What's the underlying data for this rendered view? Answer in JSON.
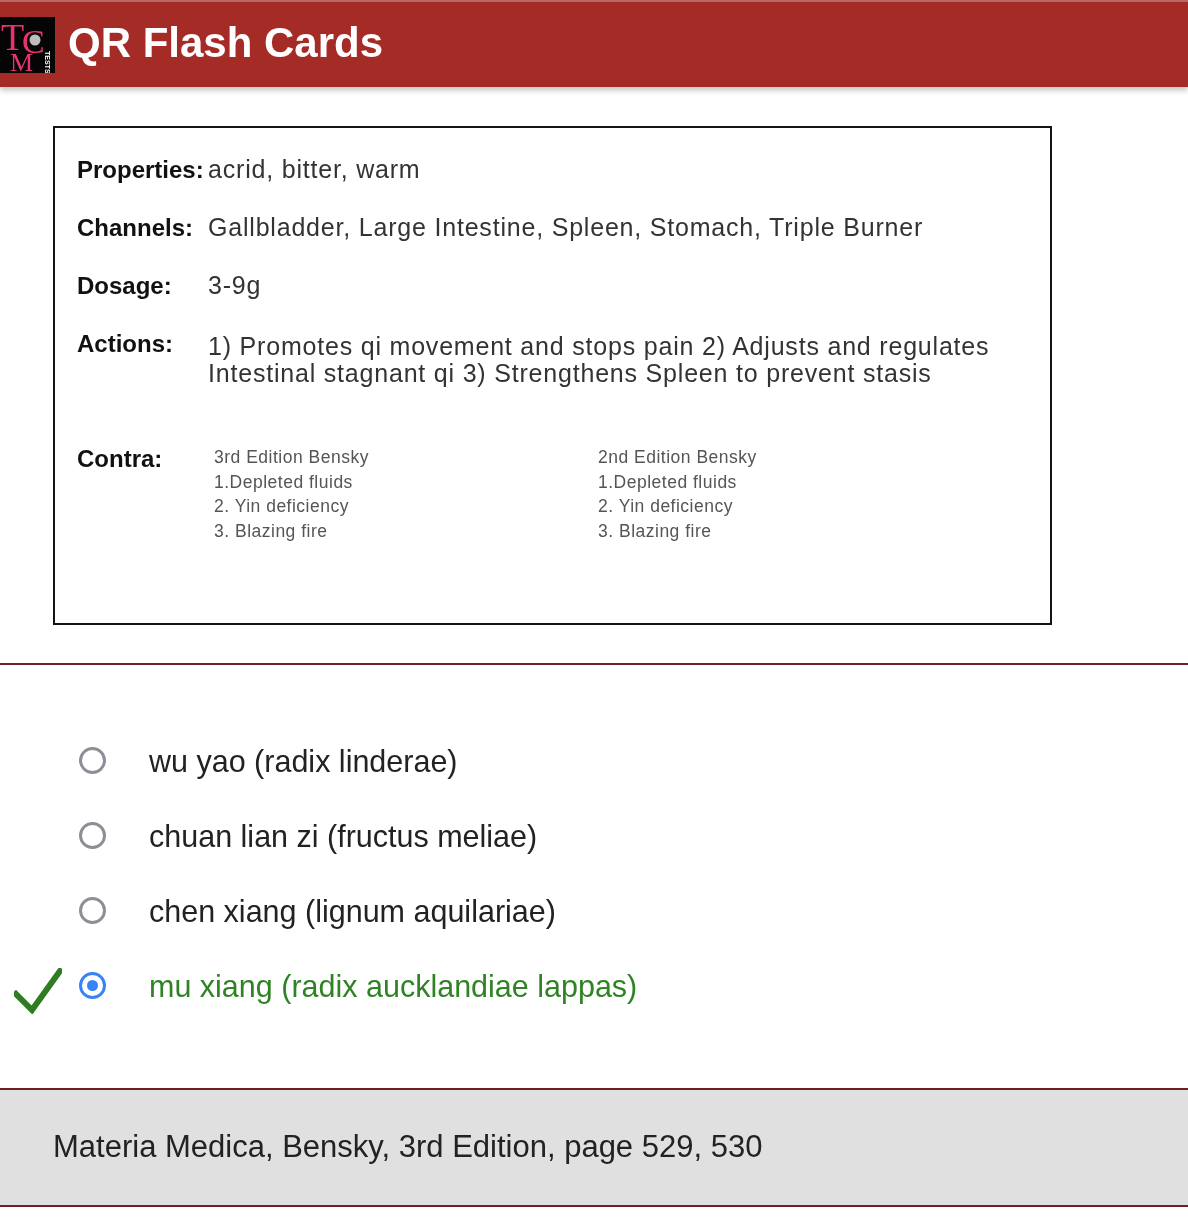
{
  "header": {
    "logo": {
      "letters": [
        "T",
        "C",
        "M"
      ],
      "tag": "TESTS"
    },
    "title": "QR Flash Cards"
  },
  "card": {
    "rows": [
      {
        "kind": "text",
        "label": "Properties:",
        "value": "acrid, bitter, warm"
      },
      {
        "kind": "text",
        "label": "Channels:",
        "value": "Gallbladder, Large Intestine, Spleen, Stomach, Triple Burner"
      },
      {
        "kind": "text",
        "label": "Dosage:",
        "value": "3-9g"
      },
      {
        "kind": "text",
        "label": "Actions:",
        "value": "1) Promotes qi movement and stops pain 2) Adjusts and regulates Intestinal stagnant qi 3) Strengthens Spleen to prevent stasis"
      },
      {
        "kind": "columns",
        "label": "Contra:",
        "columns": [
          {
            "heading": "3rd Edition Bensky",
            "items": [
              "1.Depleted fluids",
              "2. Yin deficiency",
              "3. Blazing fire"
            ]
          },
          {
            "heading": "2nd Edition Bensky",
            "items": [
              "1.Depleted fluids",
              "2. Yin deficiency",
              "3. Blazing fire"
            ]
          }
        ]
      }
    ]
  },
  "options": [
    {
      "label": "wu yao (radix linderae)",
      "selected": false,
      "correct": false
    },
    {
      "label": "chuan lian zi (fructus meliae)",
      "selected": false,
      "correct": false
    },
    {
      "label": "chen xiang (lignum aquilariae)",
      "selected": false,
      "correct": false
    },
    {
      "label": "mu xiang (radix aucklandiae lappas)",
      "selected": true,
      "correct": true
    }
  ],
  "footer": {
    "text": "Materia Medica, Bensky, 3rd Edition, page 529, 530"
  }
}
